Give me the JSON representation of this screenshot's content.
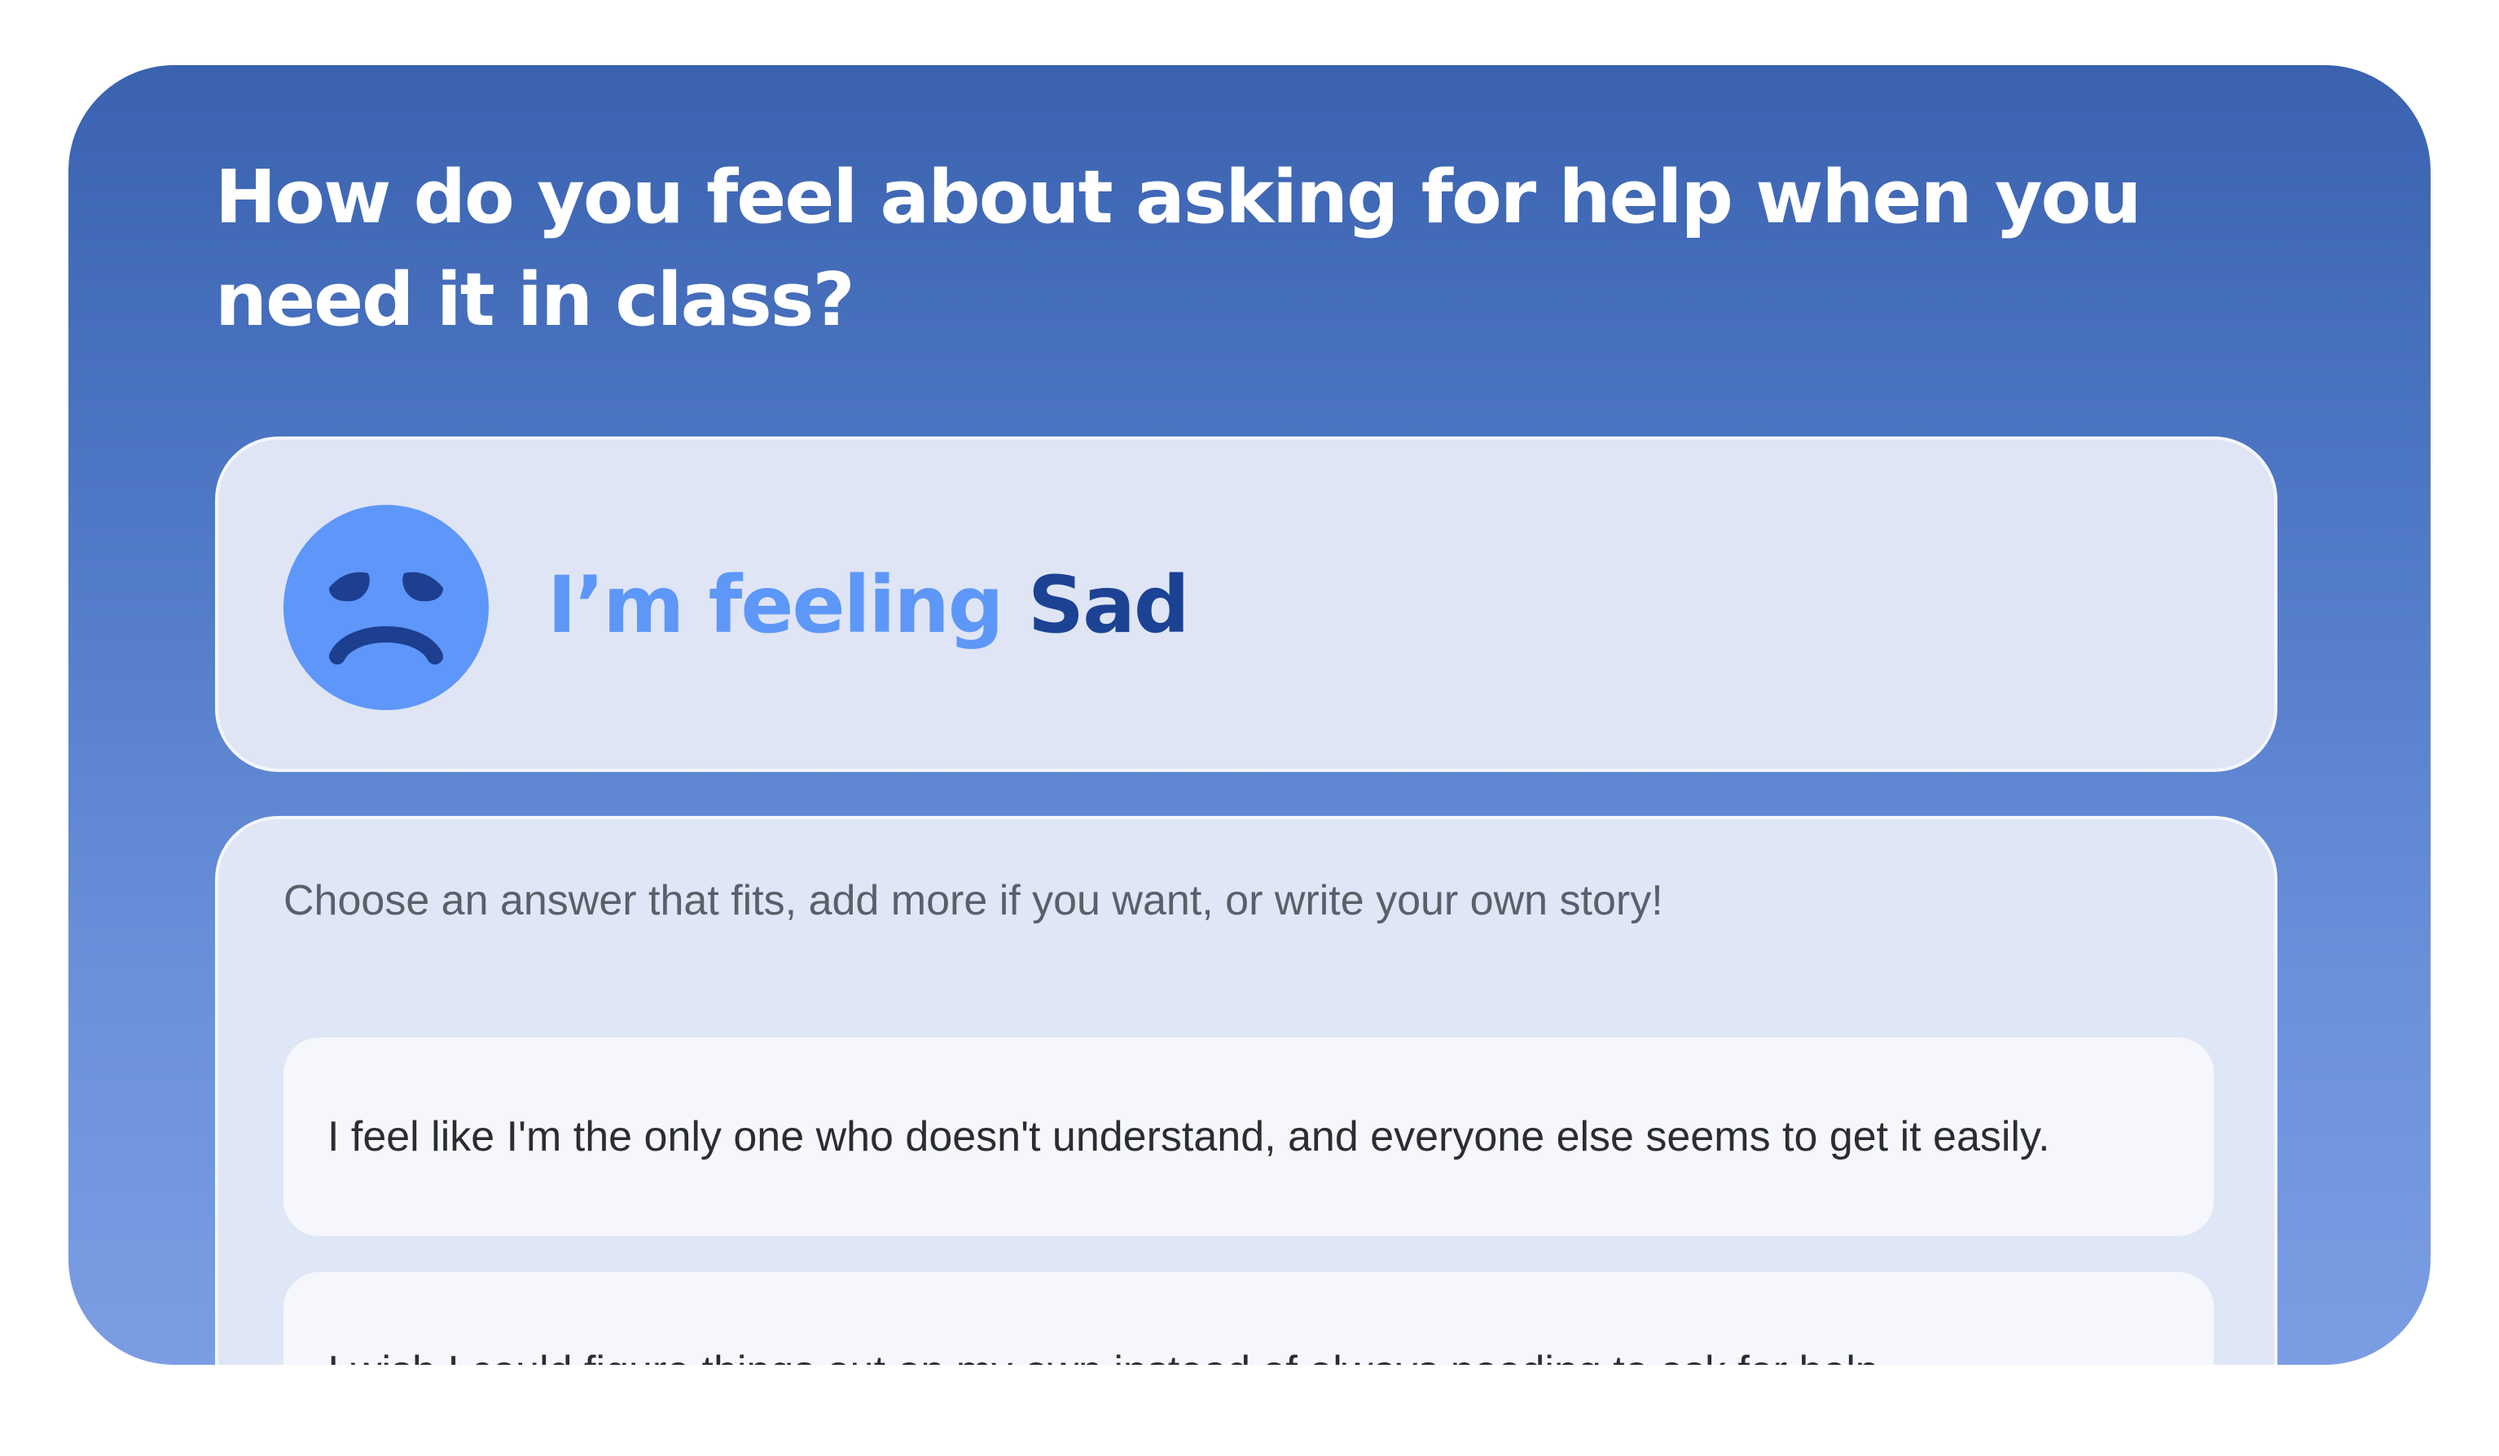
{
  "question": "How do you feel about asking for help when you need it in class?",
  "feeling": {
    "prefix": "I’m feeling",
    "emotion": "Sad",
    "face_icon": "sad-face-icon",
    "face_color": "#5e96fa",
    "face_feature_color": "#1c3f8f"
  },
  "answers": {
    "instructions": "Choose an answer that fits, add more if you want, or write your own story!",
    "options": [
      {
        "text": "I feel like I'm the only one who doesn't understand, and everyone else seems to get it easily."
      },
      {
        "text": "I wish I could figure things out on my own instead of always needing to ask for help."
      }
    ]
  },
  "colors": {
    "background_top": "#3a62af",
    "background_bottom": "#7b9de3",
    "card_background": "#dfe5f4",
    "option_background": "#f5f7fc",
    "accent_light": "#5d97f8",
    "accent_dark": "#1c4294"
  }
}
